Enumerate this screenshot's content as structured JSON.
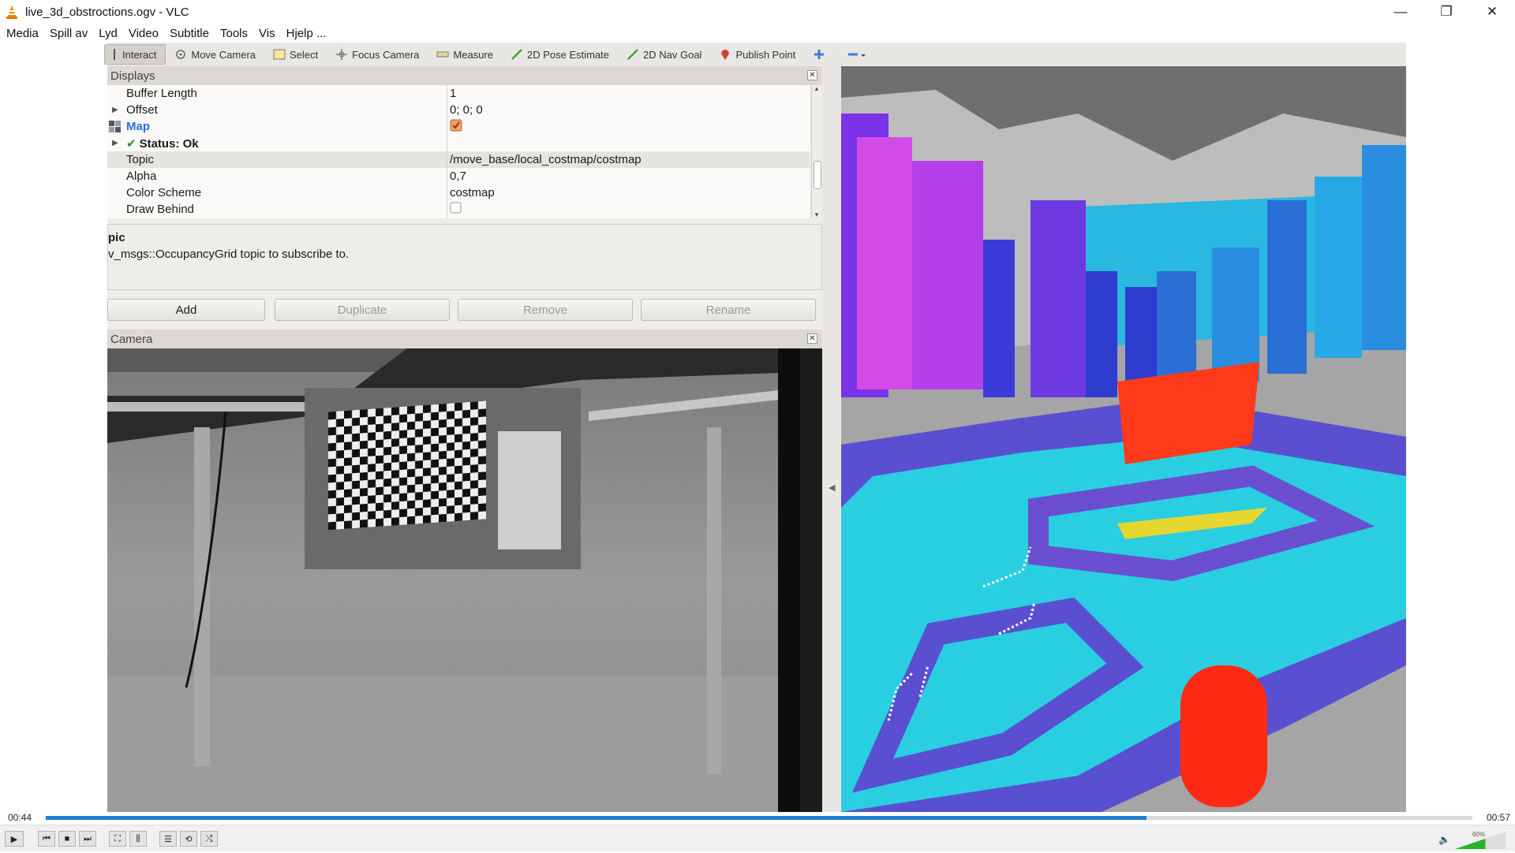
{
  "window": {
    "title": "live_3d_obstroctions.ogv - VLC",
    "controls": {
      "minimize": "—",
      "restore": "❐",
      "close": "✕"
    }
  },
  "menu": [
    "Media",
    "Spill av",
    "Lyd",
    "Video",
    "Subtitle",
    "Tools",
    "Vis",
    "Hjelp ..."
  ],
  "rviz": {
    "toolbar": [
      {
        "label": "Interact",
        "icon": "interact-icon"
      },
      {
        "label": "Move Camera",
        "icon": "move-camera-icon"
      },
      {
        "label": "Select",
        "icon": "select-icon"
      },
      {
        "label": "Focus Camera",
        "icon": "focus-camera-icon"
      },
      {
        "label": "Measure",
        "icon": "measure-icon"
      },
      {
        "label": "2D Pose Estimate",
        "icon": "pose-arrow-icon"
      },
      {
        "label": "2D Nav Goal",
        "icon": "nav-goal-icon"
      },
      {
        "label": "Publish Point",
        "icon": "map-pin-icon"
      }
    ],
    "displays": {
      "title": "Displays",
      "rows": [
        {
          "name": "Buffer Length",
          "value": "1"
        },
        {
          "name": "Offset",
          "value": "0; 0; 0"
        },
        {
          "name": "Map",
          "value": ""
        },
        {
          "name": "Status: Ok",
          "value": ""
        },
        {
          "name": "Topic",
          "value": "/move_base/local_costmap/costmap"
        },
        {
          "name": "Alpha",
          "value": "0,7"
        },
        {
          "name": "Color Scheme",
          "value": "costmap"
        },
        {
          "name": "Draw Behind",
          "value": ""
        }
      ],
      "description_title": "pic",
      "description_text": "v_msgs::OccupancyGrid topic to subscribe to.",
      "buttons": {
        "add": "Add",
        "duplicate": "Duplicate",
        "remove": "Remove",
        "rename": "Rename"
      }
    },
    "camera": {
      "title": "Camera"
    }
  },
  "playback": {
    "elapsed": "00:44",
    "total": "00:57",
    "progress": 0.7718,
    "volume_label": "60%",
    "volume": 0.6
  },
  "colors": {
    "accent": "#1e7fd3",
    "map_blue": "#2a6fd6",
    "costmap_cyan": "#29cfe0",
    "costmap_magenta": "#d24ae8",
    "obstacle_red": "#ff3a1a"
  }
}
